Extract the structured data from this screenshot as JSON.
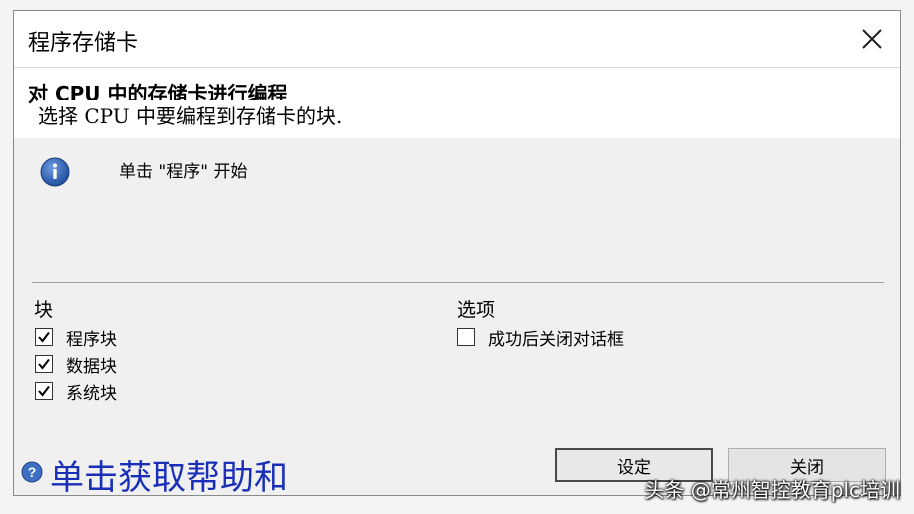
{
  "window": {
    "title": "程序存储卡",
    "close_icon": "close-x-icon"
  },
  "header": {
    "title": "对 CPU 中的存储卡进行编程",
    "subtitle": "选择 CPU 中要编程到存储卡的块."
  },
  "info": {
    "icon": "info-icon",
    "text": "单击 \"程序\" 开始"
  },
  "blocks": {
    "title": "块",
    "items": [
      {
        "label": "程序块",
        "checked": true
      },
      {
        "label": "数据块",
        "checked": true
      },
      {
        "label": "系统块",
        "checked": true
      }
    ]
  },
  "options": {
    "title": "选项",
    "items": [
      {
        "label": "成功后关闭对话框",
        "checked": false
      }
    ]
  },
  "buttons": {
    "settings": "设定",
    "close": "关闭"
  },
  "help": {
    "icon": "help-icon",
    "text": "单击获取帮助和"
  },
  "watermark": "头条 @常州智控教育plc培训",
  "colors": {
    "help_text": "#1a2fb8",
    "info_icon": "#2a5db0"
  }
}
